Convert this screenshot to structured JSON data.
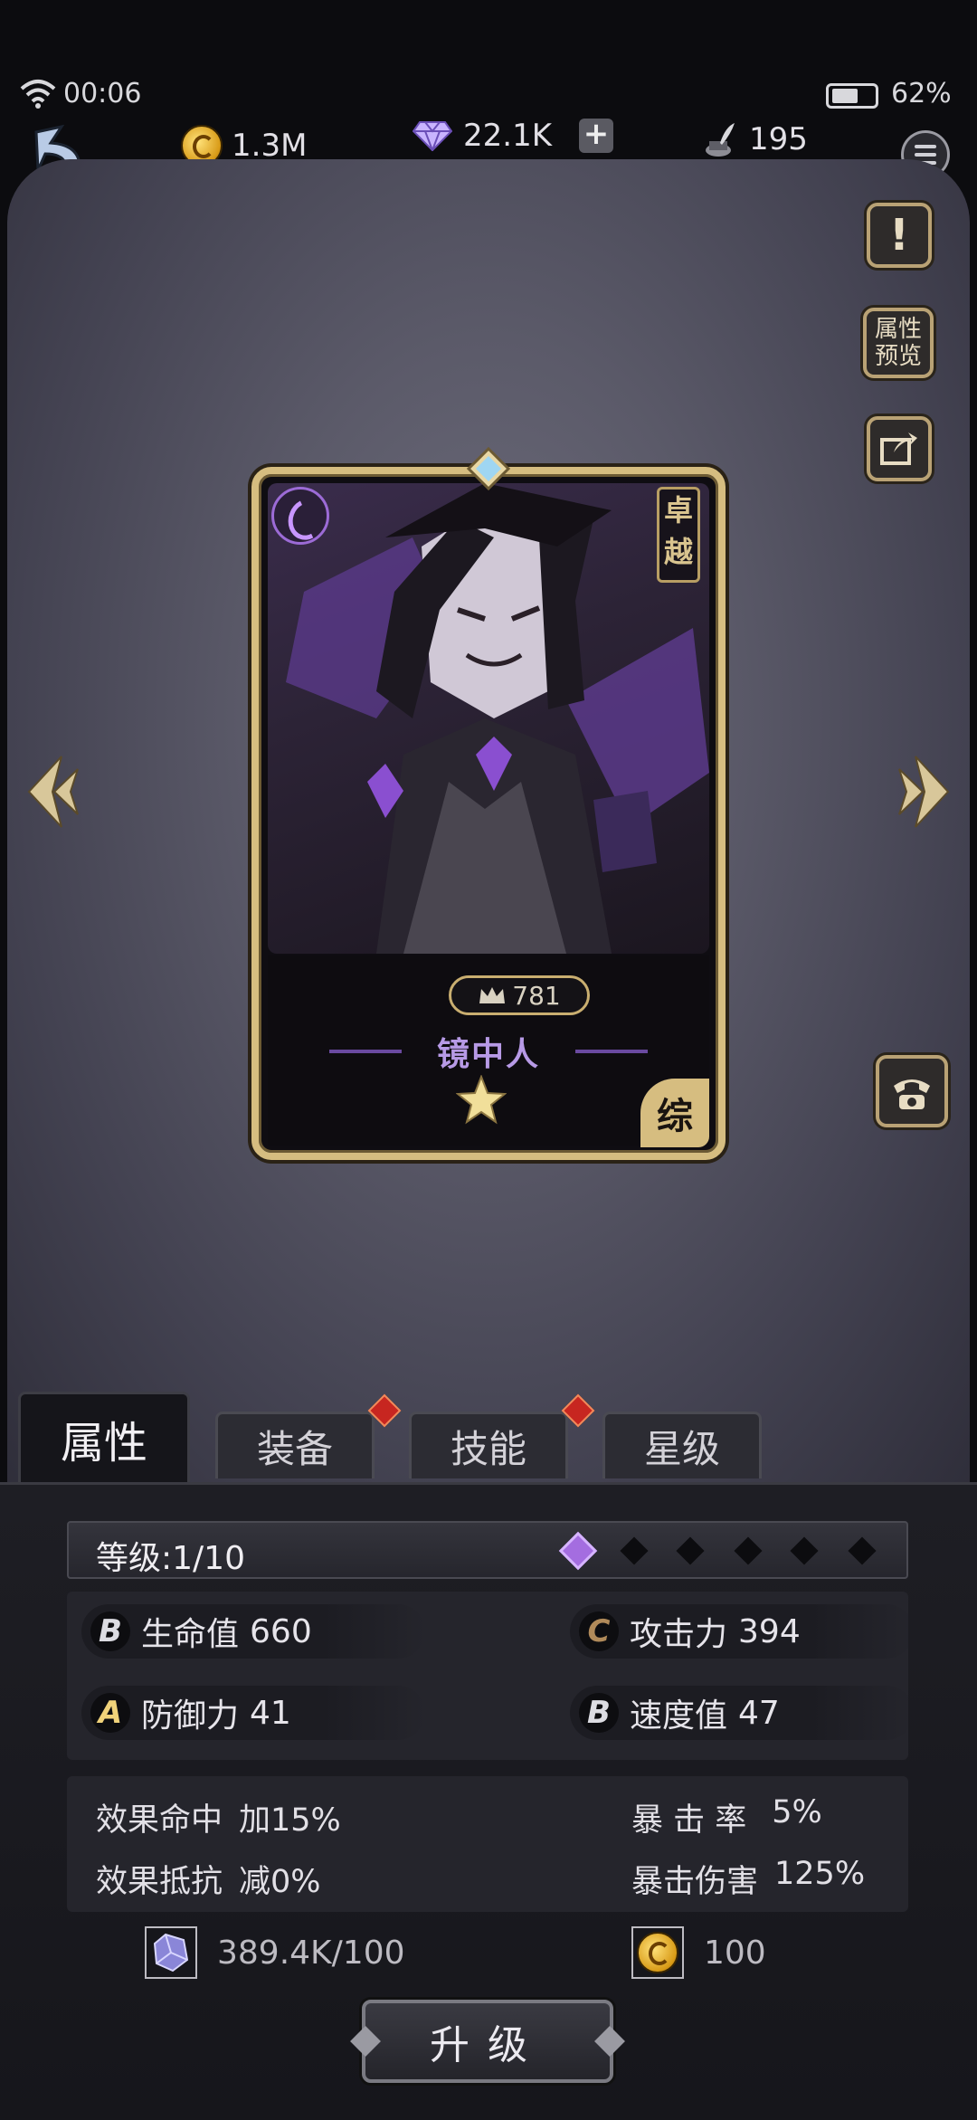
{
  "status_bar": {
    "time": "00:06",
    "battery": "62%"
  },
  "resources": {
    "gold": "1.3M",
    "diamonds": "22.1K",
    "quill": "195",
    "plus_label": "+"
  },
  "side_buttons": {
    "info": "!",
    "preview_line1": "属性",
    "preview_line2": "预览"
  },
  "hero": {
    "name": "镜中人",
    "grade_line1": "卓",
    "grade_line2": "越",
    "power": "781",
    "class_label": "综",
    "stars": 1
  },
  "tabs": [
    {
      "label": "属性",
      "active": true,
      "alert": false
    },
    {
      "label": "装备",
      "active": false,
      "alert": true
    },
    {
      "label": "技能",
      "active": false,
      "alert": true
    },
    {
      "label": "星级",
      "active": false,
      "alert": false
    }
  ],
  "level": {
    "text": "等级:1/10",
    "filled": 1,
    "total": 6
  },
  "stats": [
    {
      "grade": "B",
      "grade_color": "#dcdce2",
      "label": "生命值",
      "value": "660"
    },
    {
      "grade": "C",
      "grade_color": "#b08a5a",
      "label": "攻击力",
      "value": "394"
    },
    {
      "grade": "A",
      "grade_color": "#f0d27a",
      "label": "防御力",
      "value": "41"
    },
    {
      "grade": "B",
      "grade_color": "#dcdce2",
      "label": "速度值",
      "value": "47"
    }
  ],
  "extra_stats": [
    {
      "label": "效果命中",
      "value": "加15%"
    },
    {
      "label": "暴 击 率",
      "value": "5%"
    },
    {
      "label": "效果抵抗",
      "value": "减0%"
    },
    {
      "label": "暴击伤害",
      "value": "125%"
    }
  ],
  "costs": {
    "crystal": "389.4K/100",
    "gold": "100"
  },
  "upgrade_label": "升级",
  "colors": {
    "accent_gold": "#d6bd80",
    "accent_purple": "#a46de0",
    "alert_red": "#c72620"
  }
}
